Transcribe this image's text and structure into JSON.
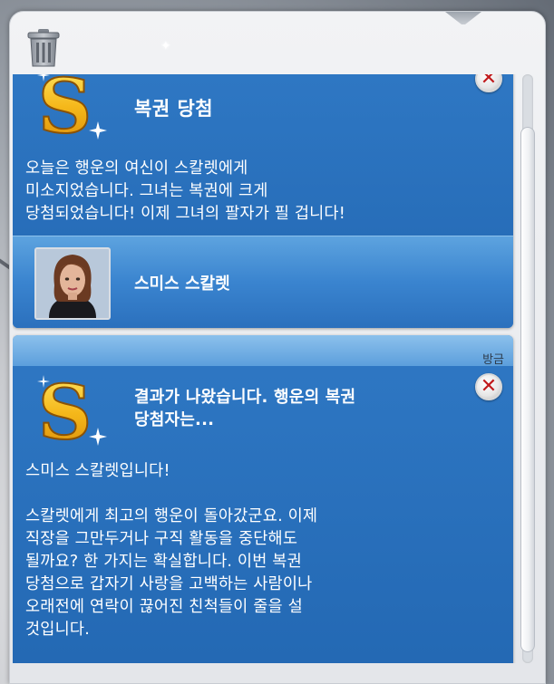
{
  "window": {
    "trash_icon": "trash-icon",
    "sparkle_icon": "sparkle-icon"
  },
  "notifications": [
    {
      "icon": "simoleon-s-icon",
      "title": "복권 당첨",
      "body": "오늘은 행운의 여신이 스칼렛에게\n미소지었습니다. 그녀는 복권에 크게\n당첨되었습니다! 이제 그녀의 팔자가 필 겁니다!",
      "sim": {
        "portrait_icon": "sim-portrait-avatar",
        "name": "스미스 스칼렛"
      },
      "close_icon": "close-icon"
    },
    {
      "time": "방금",
      "icon": "simoleon-s-icon",
      "title": "결과가 나왔습니다. 행운의 복권\n당첨자는...",
      "body": "스미스 스칼렛입니다!\n\n스칼렛에게 최고의 행운이 돌아갔군요. 이제\n직장을 그만두거나 구직 활동을 중단해도\n될까요? 한 가지는 확실합니다. 이번 복권\n당첨으로 갑자기 사랑을 고백하는 사람이나\n오래전에 연락이 끊어진 친척들이 줄을 설\n것입니다.",
      "close_icon": "close-icon"
    }
  ],
  "colors": {
    "card_blue": "#2a6fbb",
    "timebar_blue": "#7ab4e6",
    "close_red": "#c0191b",
    "coin_gold": "#f4c21a"
  }
}
